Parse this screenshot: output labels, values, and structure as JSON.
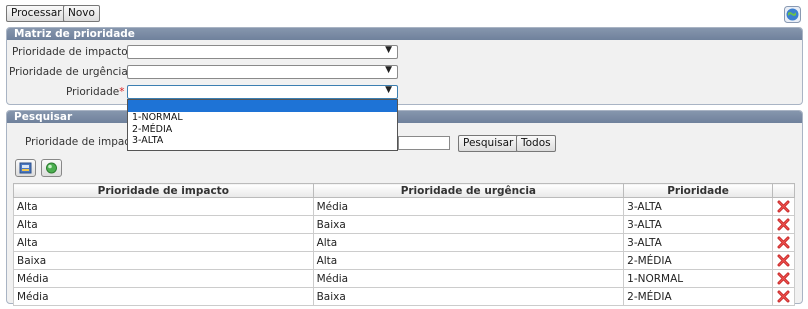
{
  "toolbar": {
    "processar": "Processar",
    "novo": "Novo"
  },
  "matriz": {
    "title": "Matriz de prioridade",
    "impacto_label": "Prioridade de impacto",
    "urgencia_label": "Prioridade de urgência",
    "prioridade_label": "Prioridade",
    "required_mark": "*",
    "colon": ":"
  },
  "dropdown": {
    "options": [
      "",
      "1-NORMAL",
      "2-MÉDIA",
      "3-ALTA"
    ]
  },
  "pesquisar": {
    "title": "Pesquisar",
    "search_label": "Prioridade de impacto",
    "search_value": "",
    "pesquisar_button": "Pesquisar",
    "todos_button": "Todos"
  },
  "table": {
    "headers": [
      "Prioridade de impacto",
      "Prioridade de urgência",
      "Prioridade"
    ],
    "rows": [
      [
        "Alta",
        "Média",
        "3-ALTA"
      ],
      [
        "Alta",
        "Baixa",
        "3-ALTA"
      ],
      [
        "Alta",
        "Alta",
        "3-ALTA"
      ],
      [
        "Baixa",
        "Alta",
        "2-MÉDIA"
      ],
      [
        "Média",
        "Média",
        "1-NORMAL"
      ],
      [
        "Média",
        "Baixa",
        "2-MÉDIA"
      ]
    ]
  },
  "icons": {
    "help": "help-globe-icon",
    "export": "export-icon",
    "refresh": "refresh-icon",
    "delete": "delete-x-icon"
  }
}
